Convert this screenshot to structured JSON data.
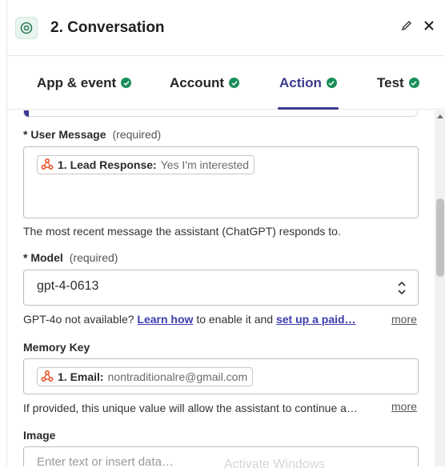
{
  "header": {
    "step_title": "2. Conversation",
    "app_icon": "openai-icon",
    "edit_icon": "pencil-icon",
    "close_icon": "close-icon"
  },
  "tabs": [
    {
      "label": "App & event",
      "complete": true,
      "active": false
    },
    {
      "label": "Account",
      "complete": true,
      "active": false
    },
    {
      "label": "Action",
      "complete": true,
      "active": true
    },
    {
      "label": "Test",
      "complete": true,
      "active": false
    }
  ],
  "fields": {
    "user_message": {
      "label": "* User Message",
      "required": "(required)",
      "pill_key": "1. Lead Response:",
      "pill_value": "Yes I'm interested",
      "help": "The most recent message the assistant (ChatGPT) responds to."
    },
    "model": {
      "label": "* Model",
      "required": "(required)",
      "value": "gpt-4-0613",
      "help_prefix": "GPT-4o not available?",
      "help_link1": "Learn how",
      "help_middle": "to enable it and",
      "help_link2": "set up a paid…",
      "more": "more"
    },
    "memory_key": {
      "label": "Memory Key",
      "pill_key": "1. Email:",
      "pill_value": "nontraditionalre@gmail.com",
      "help": "If provided, this unique value will allow the assistant to continue a…",
      "more": "more"
    },
    "image": {
      "label": "Image",
      "placeholder": "Enter text or insert data…"
    }
  },
  "watermark": "Activate Windows",
  "colors": {
    "accent": "#3b3b8f",
    "check": "#1a8f5a",
    "link": "#3b3bb0",
    "source_icon": "#e8552d"
  }
}
